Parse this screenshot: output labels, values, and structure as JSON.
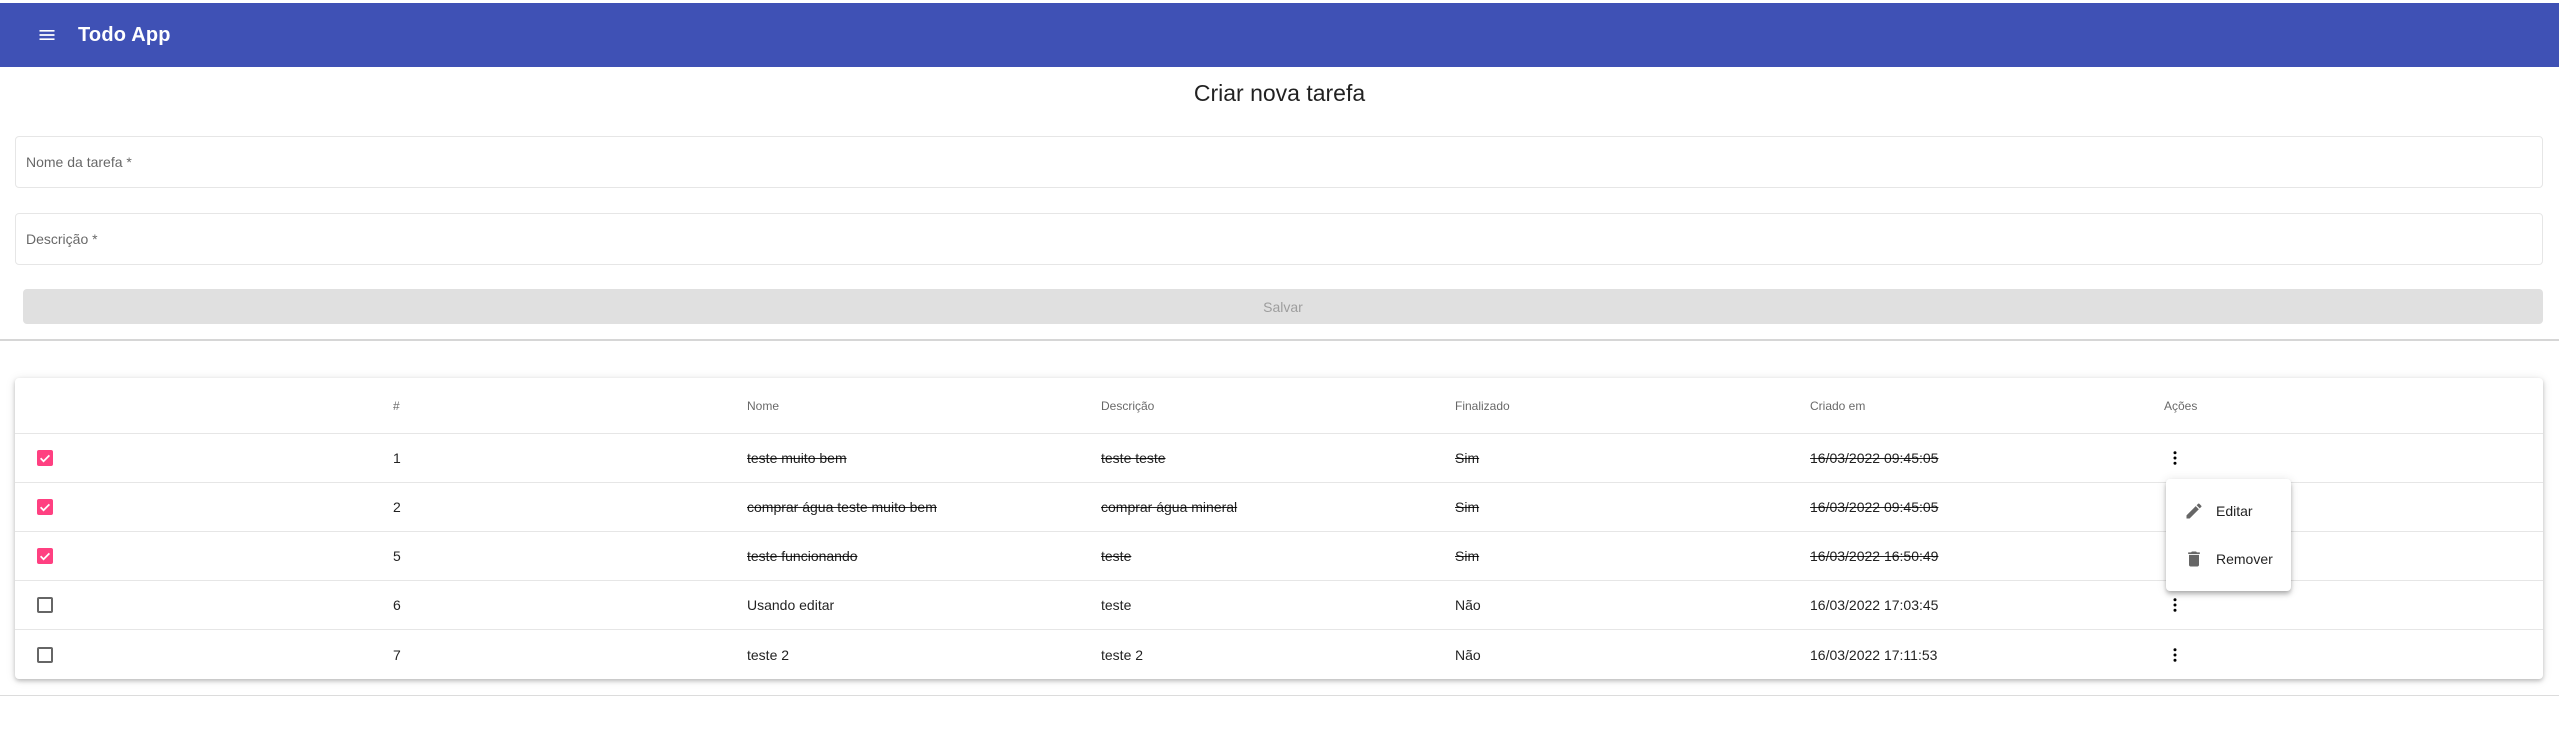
{
  "app": {
    "title": "Todo App"
  },
  "form": {
    "title": "Criar nova tarefa",
    "name_placeholder": "Nome da tarefa *",
    "description_placeholder": "Descrição *",
    "save_label": "Salvar"
  },
  "table": {
    "headers": {
      "number": "#",
      "name": "Nome",
      "description": "Descrição",
      "finished": "Finalizado",
      "created": "Criado em",
      "actions": "Ações"
    },
    "rows": [
      {
        "checked": true,
        "number": "1",
        "name": "teste muito bem",
        "description": "teste teste",
        "finished": "Sim",
        "created": "16/03/2022 09:45:05"
      },
      {
        "checked": true,
        "number": "2",
        "name": "comprar água teste muito bem",
        "description": "comprar água mineral",
        "finished": "Sim",
        "created": "16/03/2022 09:45:05"
      },
      {
        "checked": true,
        "number": "5",
        "name": "teste funcionando",
        "description": "teste",
        "finished": "Sim",
        "created": "16/03/2022 16:50:49"
      },
      {
        "checked": false,
        "number": "6",
        "name": "Usando editar",
        "description": "teste",
        "finished": "Não",
        "created": "16/03/2022 17:03:45"
      },
      {
        "checked": false,
        "number": "7",
        "name": "teste 2",
        "description": "teste 2",
        "finished": "Não",
        "created": "16/03/2022 17:11:53"
      }
    ]
  },
  "context_menu": {
    "edit_label": "Editar",
    "remove_label": "Remover"
  },
  "colors": {
    "primary": "#3f51b5",
    "accent": "#ff4081"
  }
}
